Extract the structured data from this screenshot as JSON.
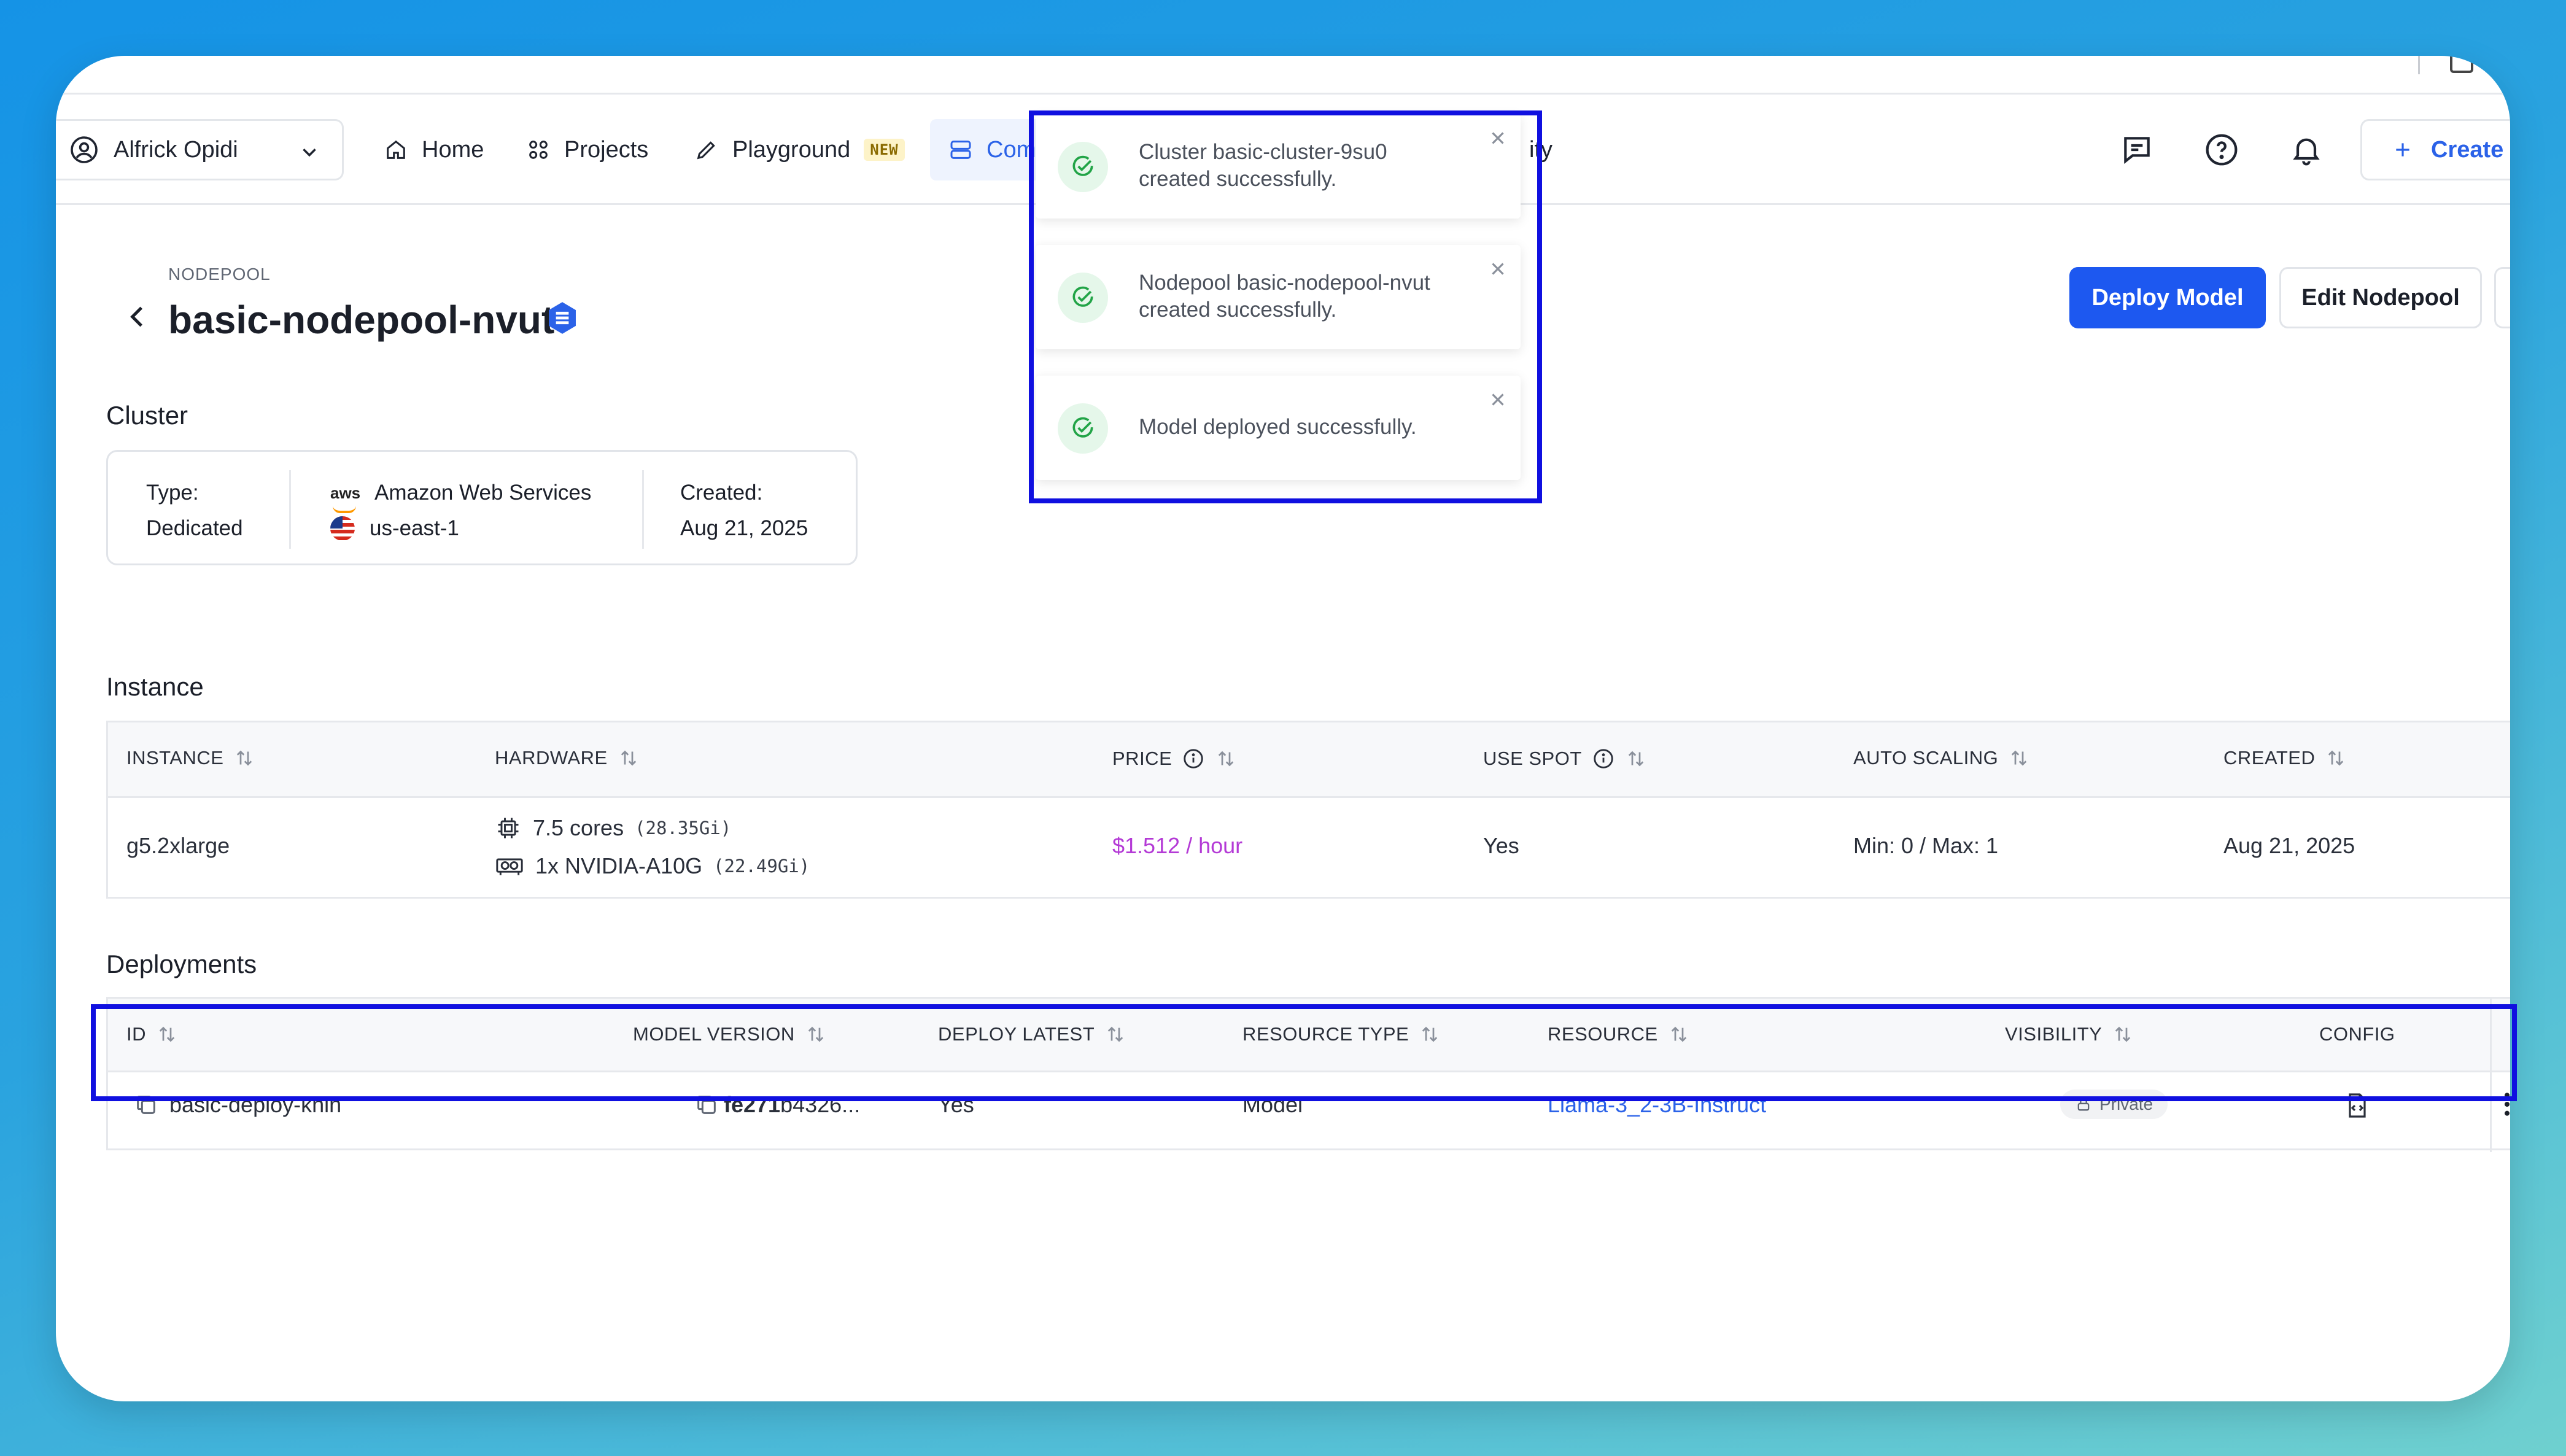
{
  "nav": {
    "user": "Alfrick Opidi",
    "items": [
      {
        "label": "Home"
      },
      {
        "label": "Projects"
      },
      {
        "label": "Playground",
        "badge": "NEW"
      },
      {
        "label": "Com"
      },
      {
        "label": "ity"
      }
    ],
    "create_label": "Create"
  },
  "header": {
    "breadcrumb": "NODEPOOL",
    "title": "basic-nodepool-nvut",
    "deploy_button": "Deploy Model",
    "edit_button": "Edit Nodepool"
  },
  "cluster": {
    "section_title": "Cluster",
    "type_label": "Type:",
    "type_value": "Dedicated",
    "provider": "Amazon Web Services",
    "region": "us-east-1",
    "created_label": "Created:",
    "created_value": "Aug 21, 2025"
  },
  "instance": {
    "section_title": "Instance",
    "columns": [
      "INSTANCE",
      "HARDWARE",
      "PRICE",
      "USE SPOT",
      "AUTO SCALING",
      "CREATED"
    ],
    "row": {
      "instance": "g5.2xlarge",
      "cores": "7.5 cores",
      "cores_mem": "(28.35Gi)",
      "gpu": "1x NVIDIA-A10G",
      "gpu_mem": "(22.49Gi)",
      "price": "$1.512 / hour",
      "use_spot": "Yes",
      "auto_scaling": "Min: 0 / Max: 1",
      "created": "Aug 21, 2025"
    }
  },
  "deployments": {
    "section_title": "Deployments",
    "columns": [
      "ID",
      "MODEL VERSION",
      "DEPLOY LATEST",
      "RESOURCE TYPE",
      "RESOURCE",
      "VISIBILITY",
      "CONFIG"
    ],
    "row": {
      "id": "basic-deploy-knin",
      "model_version_bold": "fe271",
      "model_version_rest": "b4326...",
      "deploy_latest": "Yes",
      "resource_type": "Model",
      "resource": "Llama-3_2-3B-Instruct",
      "visibility": "Private"
    }
  },
  "toasts": [
    {
      "message": "Cluster basic-cluster-9su0 created successfully."
    },
    {
      "message": "Nodepool basic-nodepool-nvut created successfully."
    },
    {
      "message": "Model deployed successfully."
    }
  ],
  "colors": {
    "accent": "#1d58f0",
    "price": "#b43ad6",
    "link": "#2b62e8",
    "success": "#22a447",
    "highlight": "#1010e0"
  }
}
